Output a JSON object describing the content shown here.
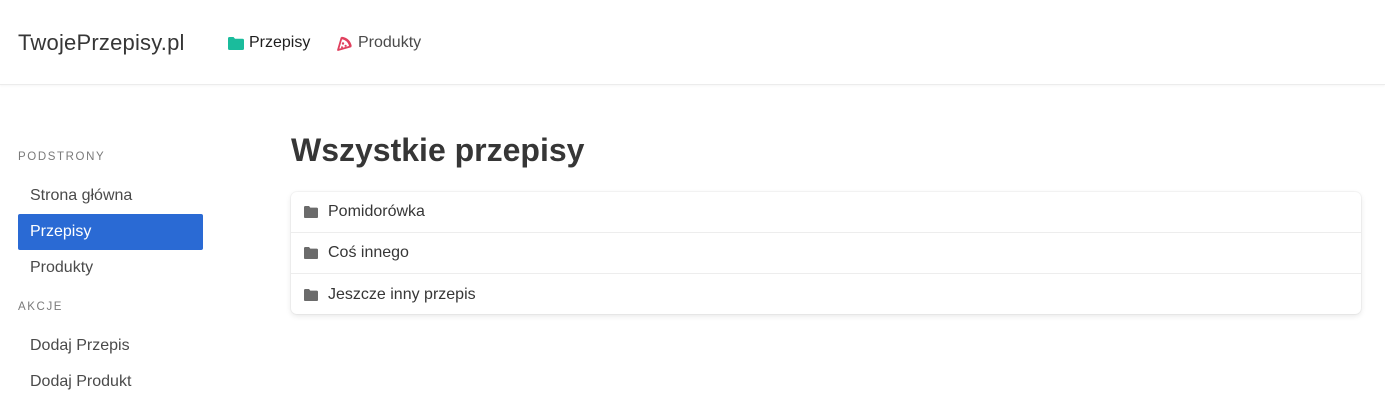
{
  "navbar": {
    "brand": "TwojePrzepisy.pl",
    "items": [
      {
        "label": "Przepisy",
        "icon": "folder-icon",
        "icon_color": "#1abc9c"
      },
      {
        "label": "Produkty",
        "icon": "pizza-icon",
        "icon_color": "#e0405e"
      }
    ]
  },
  "sidebar": {
    "sections": [
      {
        "label": "PODSTRONY",
        "items": [
          {
            "label": "Strona główna",
            "active": false
          },
          {
            "label": "Przepisy",
            "active": true
          },
          {
            "label": "Produkty",
            "active": false
          }
        ]
      },
      {
        "label": "AKCJE",
        "items": [
          {
            "label": "Dodaj Przepis",
            "active": false
          },
          {
            "label": "Dodaj Produkt",
            "active": false
          }
        ]
      }
    ]
  },
  "main": {
    "title": "Wszystkie przepisy",
    "recipes": [
      {
        "name": "Pomidorówka",
        "icon": "folder-icon"
      },
      {
        "name": "Coś innego",
        "icon": "folder-icon"
      },
      {
        "name": "Jeszcze inny przepis",
        "icon": "folder-icon"
      }
    ]
  },
  "colors": {
    "accent": "#2a6ad4",
    "folder_icon_gray": "#6b6b6b"
  }
}
